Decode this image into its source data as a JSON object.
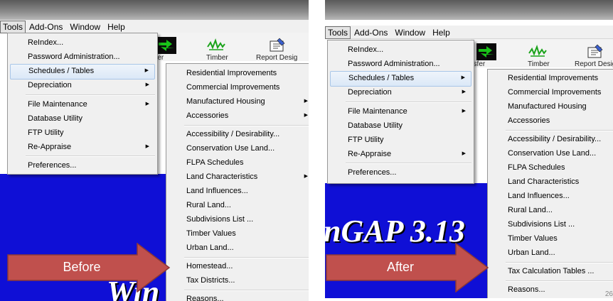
{
  "menubar": [
    "Tools",
    "Add-Ons",
    "Window",
    "Help"
  ],
  "toolbar": [
    "nsfer",
    "Timber",
    "Report Desig"
  ],
  "before": {
    "caption": "Before",
    "brand_text": "Win",
    "tools_menu": [
      {
        "label": "ReIndex...",
        "arrow": false
      },
      {
        "label": "Password Administration...",
        "arrow": false
      },
      {
        "label": "Schedules / Tables",
        "arrow": true,
        "highlighted": true
      },
      {
        "label": "Depreciation",
        "arrow": true
      },
      {
        "label": "File Maintenance",
        "arrow": true
      },
      {
        "label": "Database Utility",
        "arrow": false
      },
      {
        "label": "FTP Utility",
        "arrow": false
      },
      {
        "label": "Re-Appraise",
        "arrow": true
      },
      {
        "label": "Preferences...",
        "arrow": false
      }
    ],
    "schedules_menu": [
      {
        "label": "Residential Improvements",
        "arrow": false
      },
      {
        "label": "Commercial Improvements",
        "arrow": false
      },
      {
        "label": "Manufactured Housing",
        "arrow": true
      },
      {
        "label": "Accessories",
        "arrow": true
      },
      {
        "label": "Accessibility / Desirability...",
        "arrow": false
      },
      {
        "label": "Conservation Use Land...",
        "arrow": false
      },
      {
        "label": "FLPA Schedules",
        "arrow": false
      },
      {
        "label": "Land Characteristics",
        "arrow": true
      },
      {
        "label": "Land Influences...",
        "arrow": false
      },
      {
        "label": "Rural Land...",
        "arrow": false
      },
      {
        "label": "Subdivisions List ...",
        "arrow": false
      },
      {
        "label": "Timber Values",
        "arrow": false
      },
      {
        "label": "Urban Land...",
        "arrow": false
      },
      {
        "label": "Homestead...",
        "arrow": false
      },
      {
        "label": "Tax Districts...",
        "arrow": false
      },
      {
        "label": "Reasons...",
        "arrow": false
      }
    ]
  },
  "after": {
    "caption": "After",
    "brand_text": "nGAP 3.13",
    "page_number": "26",
    "tools_menu": [
      {
        "label": "ReIndex...",
        "arrow": false
      },
      {
        "label": "Password Administration...",
        "arrow": false
      },
      {
        "label": "Schedules / Tables",
        "arrow": true,
        "highlighted": true
      },
      {
        "label": "Depreciation",
        "arrow": true
      },
      {
        "label": "File Maintenance",
        "arrow": true
      },
      {
        "label": "Database Utility",
        "arrow": false
      },
      {
        "label": "FTP Utility",
        "arrow": false
      },
      {
        "label": "Re-Appraise",
        "arrow": true
      },
      {
        "label": "Preferences...",
        "arrow": false
      }
    ],
    "schedules_menu": [
      {
        "label": "Residential Improvements",
        "arrow": false
      },
      {
        "label": "Commercial Improvements",
        "arrow": false
      },
      {
        "label": "Manufactured Housing",
        "arrow": true
      },
      {
        "label": "Accessories",
        "arrow": true
      },
      {
        "label": "Accessibility / Desirability...",
        "arrow": false
      },
      {
        "label": "Conservation Use Land...",
        "arrow": false
      },
      {
        "label": "FLPA Schedules",
        "arrow": false
      },
      {
        "label": "Land Characteristics",
        "arrow": true
      },
      {
        "label": "Land Influences...",
        "arrow": false
      },
      {
        "label": "Rural Land...",
        "arrow": false
      },
      {
        "label": "Subdivisions List ...",
        "arrow": false
      },
      {
        "label": "Timber Values",
        "arrow": false
      },
      {
        "label": "Urban Land...",
        "arrow": false
      },
      {
        "label": "Tax Calculation Tables ...",
        "arrow": false
      },
      {
        "label": "Reasons...",
        "arrow": false
      }
    ]
  },
  "colors": {
    "app_blue": "#0f0fd6",
    "callout_red": "#c0504d",
    "highlight": "#dbe8f7"
  }
}
